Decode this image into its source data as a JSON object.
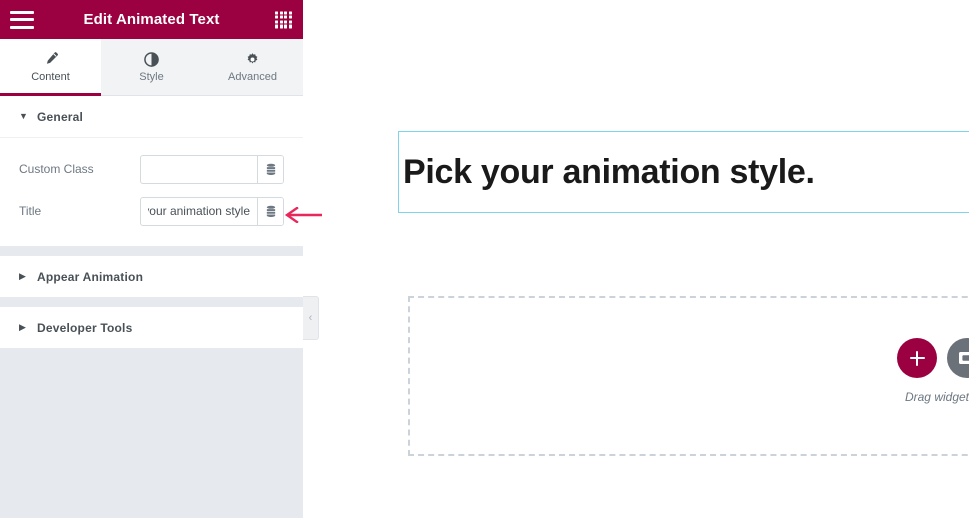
{
  "panel": {
    "header": {
      "title": "Edit Animated Text",
      "menu_icon": "hamburger-icon",
      "grid_icon": "widgets-grid-icon",
      "background_color": "#9B0040"
    },
    "tabs": [
      {
        "label": "Content",
        "icon": "pencil-icon",
        "active": true
      },
      {
        "label": "Style",
        "icon": "half-circle-icon",
        "active": false
      },
      {
        "label": "Advanced",
        "icon": "gear-icon",
        "active": false
      }
    ],
    "sections": [
      {
        "title": "General",
        "expanded": true,
        "caret": "caret-down-icon",
        "controls": [
          {
            "label": "Custom Class",
            "value": "",
            "placeholder": "",
            "dynamic_icon": "database-stack-icon"
          },
          {
            "label": "Title",
            "value": "Pick your animation style.",
            "placeholder": "",
            "dynamic_icon": "database-stack-icon"
          }
        ]
      },
      {
        "title": "Appear Animation",
        "expanded": false,
        "caret": "caret-right-icon",
        "controls": []
      },
      {
        "title": "Developer Tools",
        "expanded": false,
        "caret": "caret-right-icon",
        "controls": []
      }
    ],
    "collapse_handle": {
      "icon": "chevron-left-icon",
      "label": "‹"
    }
  },
  "annotation": {
    "arrow_icon": "arrow-left-annotation",
    "color": "#E8275A"
  },
  "canvas": {
    "heading": {
      "text": "Pick your animation style.",
      "selected": true,
      "selection_color": "#7FD4EA"
    },
    "dropzone": {
      "add_button": {
        "icon": "plus-icon",
        "color": "#9B0040"
      },
      "template_button": {
        "icon": "folder-template-icon",
        "color": "#6A7178"
      },
      "hint_text": "Drag widget h"
    }
  }
}
